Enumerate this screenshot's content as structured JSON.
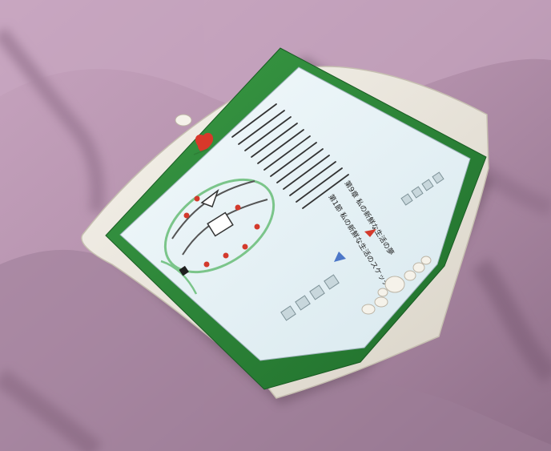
{
  "scene": {
    "subject": "tablet-device",
    "background": "draped-fabric",
    "colors": {
      "fabric": "#b592ad",
      "fabric_shadow": "#7d5f78",
      "bezel_green": "#2e8a3a",
      "housing": "#ece8df",
      "screen": "#e9f3f6",
      "logo_red": "#d8382a"
    }
  },
  "device": {
    "logo_icon": "heart-logo-icon",
    "screen_text": {
      "heading_line_1": "第9章 私の新鮮な生活の夢",
      "heading_line_2": "第1節 私の新鮮な生活のスケッチ"
    },
    "hardware_buttons": [
      {
        "name": "top-button"
      },
      {
        "name": "pad-button-1"
      },
      {
        "name": "pad-button-2"
      },
      {
        "name": "pad-button-3"
      },
      {
        "name": "pad-button-4"
      },
      {
        "name": "pad-button-5"
      },
      {
        "name": "pad-button-6"
      },
      {
        "name": "dpad-center"
      }
    ]
  }
}
